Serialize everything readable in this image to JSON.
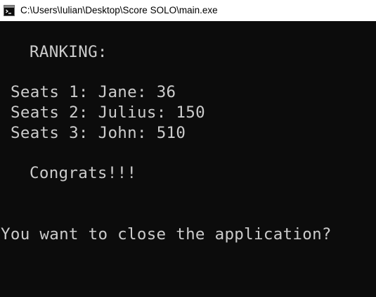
{
  "window": {
    "title": "C:\\Users\\Iulian\\Desktop\\Score SOLO\\main.exe",
    "icon": "console-app-icon"
  },
  "console": {
    "heading": "RANKING:",
    "ranking": [
      "Seats 1: Jane: 36",
      "Seats 2: Julius: 150",
      "Seats 3: John: 510"
    ],
    "congrats": "Congrats!!!",
    "prompt": "You want to close the application?"
  },
  "colors": {
    "background": "#0c0c0c",
    "text": "#cccccc",
    "titlebar": "#ffffff"
  }
}
